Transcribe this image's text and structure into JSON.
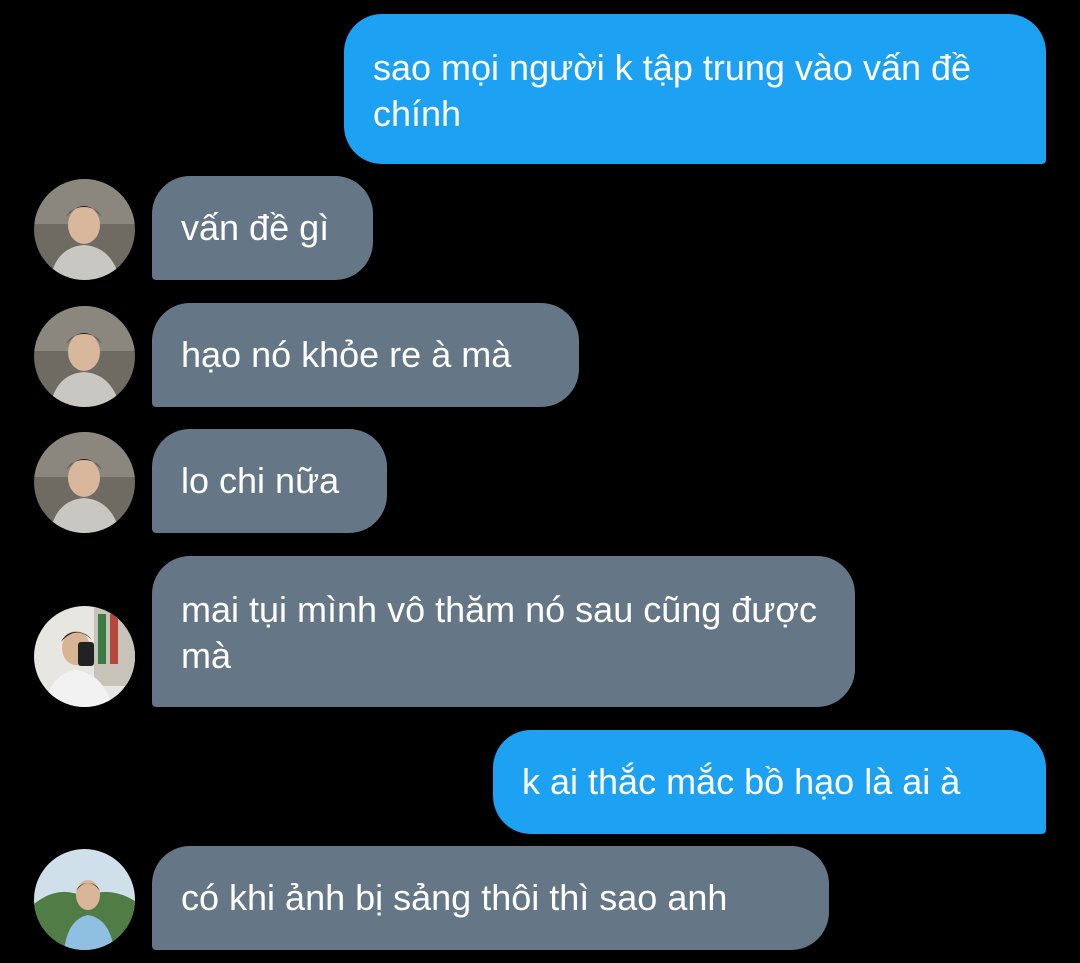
{
  "conversation": {
    "messages": [
      {
        "from": "me",
        "text": "sao mọi người k tập trung vào vấn đề chính"
      },
      {
        "from": "user-a",
        "avatar": "avatar-user-a",
        "text": "vấn đề gì"
      },
      {
        "from": "user-a",
        "avatar": "avatar-user-a",
        "text": "hạo nó khỏe re à mà"
      },
      {
        "from": "user-a",
        "avatar": "avatar-user-a",
        "text": "lo chi nữa"
      },
      {
        "from": "user-b",
        "avatar": "avatar-user-b",
        "text": "mai tụi mình vô thăm nó sau cũng được mà"
      },
      {
        "from": "me",
        "text": "k ai thắc mắc bồ hạo là ai à"
      },
      {
        "from": "user-c",
        "avatar": "avatar-user-c",
        "text": "có khi ảnh bị sảng thôi thì sao anh"
      }
    ]
  },
  "colors": {
    "background": "#000000",
    "sent_bubble": "#1da1f2",
    "received_bubble": "#657786",
    "text": "#ffffff"
  }
}
